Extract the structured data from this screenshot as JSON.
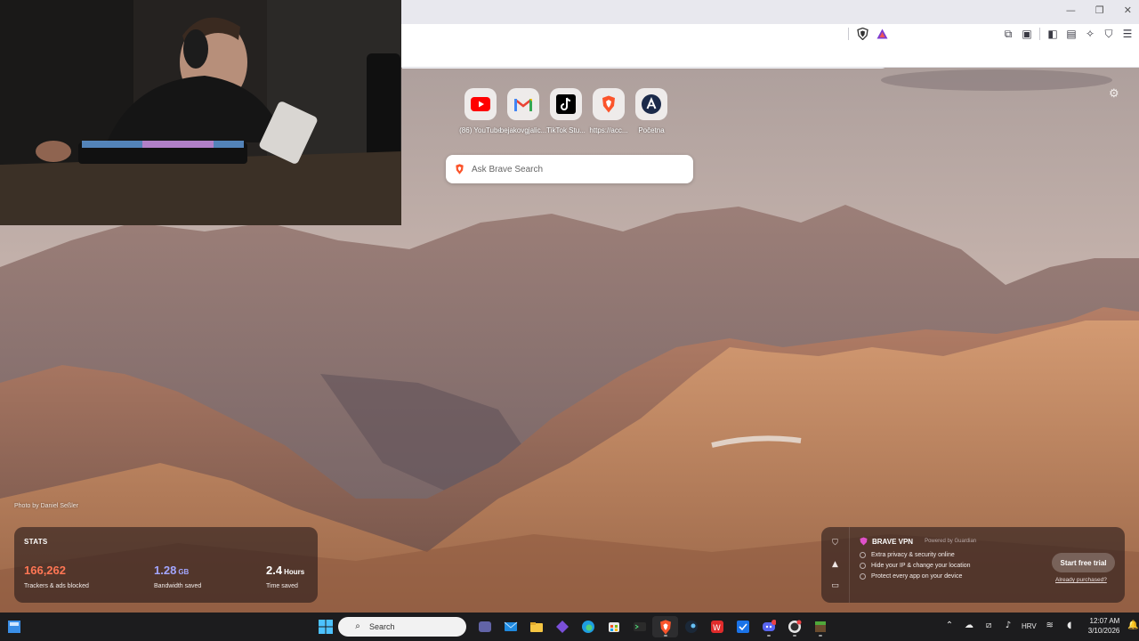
{
  "browser": {
    "window_controls": [
      "—",
      "❐",
      "✕"
    ]
  },
  "topsites": [
    {
      "label": "(86) YouTube",
      "icon": "youtube-icon",
      "color": "#ff0000"
    },
    {
      "label": "bejakovgjalic...",
      "icon": "gmail-icon",
      "color": "#ea4335"
    },
    {
      "label": "TikTok Stu...",
      "icon": "tiktok-icon",
      "color": "#000000"
    },
    {
      "label": "https://acc...",
      "icon": "brave-icon",
      "color": "#fb542b"
    },
    {
      "label": "Početna",
      "icon": "account-icon",
      "color": "#1b2a4a"
    }
  ],
  "search": {
    "placeholder": "Ask Brave Search"
  },
  "photo_credit": "Photo by Daniel Seßler",
  "stats": {
    "title": "STATS",
    "trackers": {
      "value": "166,262",
      "desc": "Trackers & ads blocked",
      "color": "#ff7654"
    },
    "bandwidth": {
      "value": "1.28",
      "unit": "GB",
      "desc": "Bandwidth saved",
      "color": "#a3a6ff"
    },
    "time": {
      "value": "2.4",
      "unit": "Hours",
      "desc": "Time saved",
      "color": "#ffffff"
    }
  },
  "vpn": {
    "title": "BRAVE VPN",
    "powered": "Powered by Guardian",
    "features": [
      "Extra privacy & security online",
      "Hide your IP & change your location",
      "Protect every app on your device"
    ],
    "cta": "Start free trial",
    "link": "Already purchased?"
  },
  "taskbar": {
    "search_label": "Search",
    "language": "HRV",
    "time": "12:07 AM",
    "date": "3/10/2026"
  }
}
